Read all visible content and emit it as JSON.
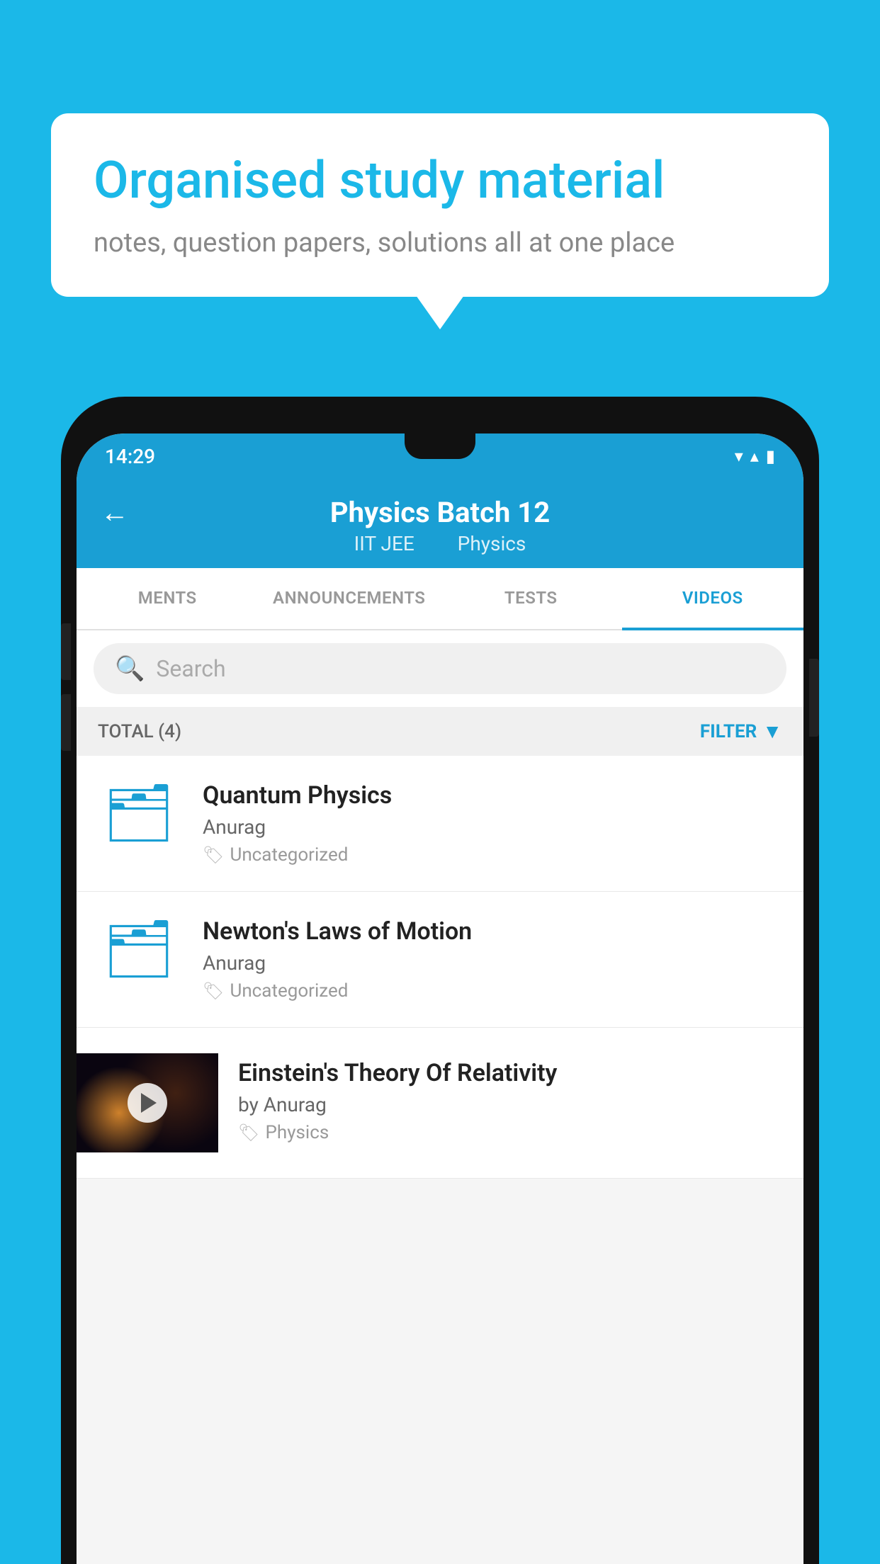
{
  "background_color": "#1bb8e8",
  "speech_bubble": {
    "heading": "Organised study material",
    "subtext": "notes, question papers, solutions all at one place"
  },
  "phone": {
    "status_bar": {
      "time": "14:29",
      "wifi": "▼",
      "signal": "▲",
      "battery": "▮"
    },
    "header": {
      "back_label": "←",
      "title": "Physics Batch 12",
      "subtitle_part1": "IIT JEE",
      "subtitle_part2": "Physics"
    },
    "tabs": [
      {
        "label": "MENTS",
        "active": false
      },
      {
        "label": "ANNOUNCEMENTS",
        "active": false
      },
      {
        "label": "TESTS",
        "active": false
      },
      {
        "label": "VIDEOS",
        "active": true
      }
    ],
    "search": {
      "placeholder": "Search"
    },
    "filter_bar": {
      "total_label": "TOTAL (4)",
      "filter_label": "FILTER"
    },
    "videos": [
      {
        "id": 1,
        "title": "Quantum Physics",
        "author": "Anurag",
        "tag": "Uncategorized",
        "has_thumbnail": false
      },
      {
        "id": 2,
        "title": "Newton's Laws of Motion",
        "author": "Anurag",
        "tag": "Uncategorized",
        "has_thumbnail": false
      },
      {
        "id": 3,
        "title": "Einstein's Theory Of Relativity",
        "author": "by Anurag",
        "tag": "Physics",
        "has_thumbnail": true
      }
    ]
  }
}
